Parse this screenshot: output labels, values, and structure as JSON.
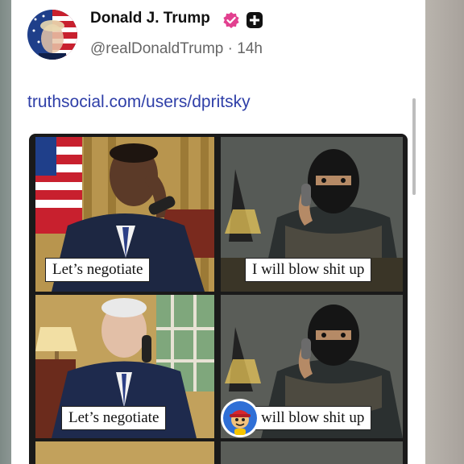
{
  "post": {
    "author_name": "Donald J. Trump",
    "handle": "@realDonaldTrump",
    "separator": "·",
    "time": "14h",
    "link_text": "truthsocial.com/users/dpritsky"
  },
  "meme": {
    "captions": [
      "Let’s negotiate",
      "I will blow shit up",
      "Let’s negotiate",
      "I will blow shit up"
    ]
  },
  "icons": [
    "verified-badge-icon",
    "plus-icon"
  ],
  "colors": {
    "link": "#2f3fa8",
    "verified_badge": "#e2408f",
    "name": "#111111",
    "handle": "#666666"
  }
}
